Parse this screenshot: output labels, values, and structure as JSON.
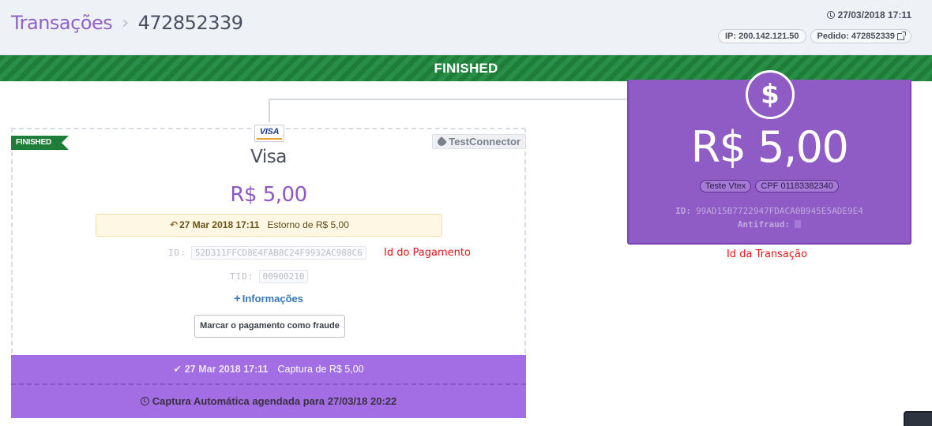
{
  "header": {
    "breadcrumb_root": "Transações",
    "breadcrumb_sep": "›",
    "transaction_id": "472852339",
    "date": "27/03/2018 17:11",
    "ip": "IP: 200.142.121.50",
    "order": "Pedido: 472852339"
  },
  "status_bar": {
    "label": "FINISHED"
  },
  "payment_card": {
    "ribbon": "FINISHED",
    "brand_logo_text": "VISA",
    "brand_name": "Visa",
    "connector": "TestConnector",
    "amount": "R$ 5,00",
    "refund": {
      "arrow": "↶",
      "date": "27 Mar 2018 17:11",
      "text": "Estorno de R$ 5,00"
    },
    "id_label": "ID:",
    "id_value": "52D311FFCD8E4FAB8C24F9932AC988C6",
    "id_annotation": "Id do Pagamento",
    "tid_label": "TID:",
    "tid_value": "00900210",
    "info_plus": "+",
    "info_link": "Informações",
    "fraud_button": "Marcar o pagamento como fraude",
    "capture": {
      "check": "✔",
      "date": "27 Mar 2018 17:11",
      "text": "Captura de R$ 5,00"
    },
    "auto_capture": "Captura Automática agendada para 27/03/18 20:22"
  },
  "transaction_box": {
    "icon_symbol": "$",
    "amount": "R$ 5,00",
    "tag_seller": "Teste Vtex",
    "tag_cpf": "CPF 01183382340",
    "id_label": "ID:",
    "id_value": "99AD15B7722947FDACA0B945E5ADE9E4",
    "antifraud_label": "Antifraud:",
    "annotation": "Id da Transação"
  },
  "colors": {
    "accent_purple": "#8f5bc5",
    "status_green": "#1f7d3a",
    "annotation_red": "#e0151c",
    "link_blue": "#3a78b8"
  },
  "icons": {
    "clock": "clock-icon",
    "external_link": "external-link-icon",
    "plug": "plug-icon",
    "undo": "undo-arrow-icon",
    "check": "check-icon",
    "plus": "plus-icon",
    "dollar": "dollar-icon"
  }
}
